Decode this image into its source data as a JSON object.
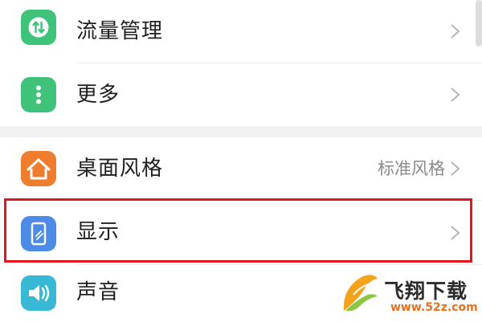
{
  "settings": {
    "items": [
      {
        "label": "流量管理",
        "icon": "data-usage-icon",
        "color": "#3fc27a"
      },
      {
        "label": "更多",
        "icon": "more-icon",
        "color": "#3fc27a"
      },
      {
        "label": "桌面风格",
        "value": "标准风格",
        "icon": "home-icon",
        "color": "#ef7d2e"
      },
      {
        "label": "显示",
        "icon": "display-icon",
        "color": "#4d8be6"
      },
      {
        "label": "声音",
        "icon": "sound-icon",
        "color": "#37b9d6"
      }
    ]
  },
  "watermark": {
    "brand": "飞翔下载",
    "url": "www.52z.com",
    "logo": "feixiang-logo-icon"
  },
  "colors": {
    "highlight": "#e4141e",
    "watermark_url": "#e8701c"
  }
}
